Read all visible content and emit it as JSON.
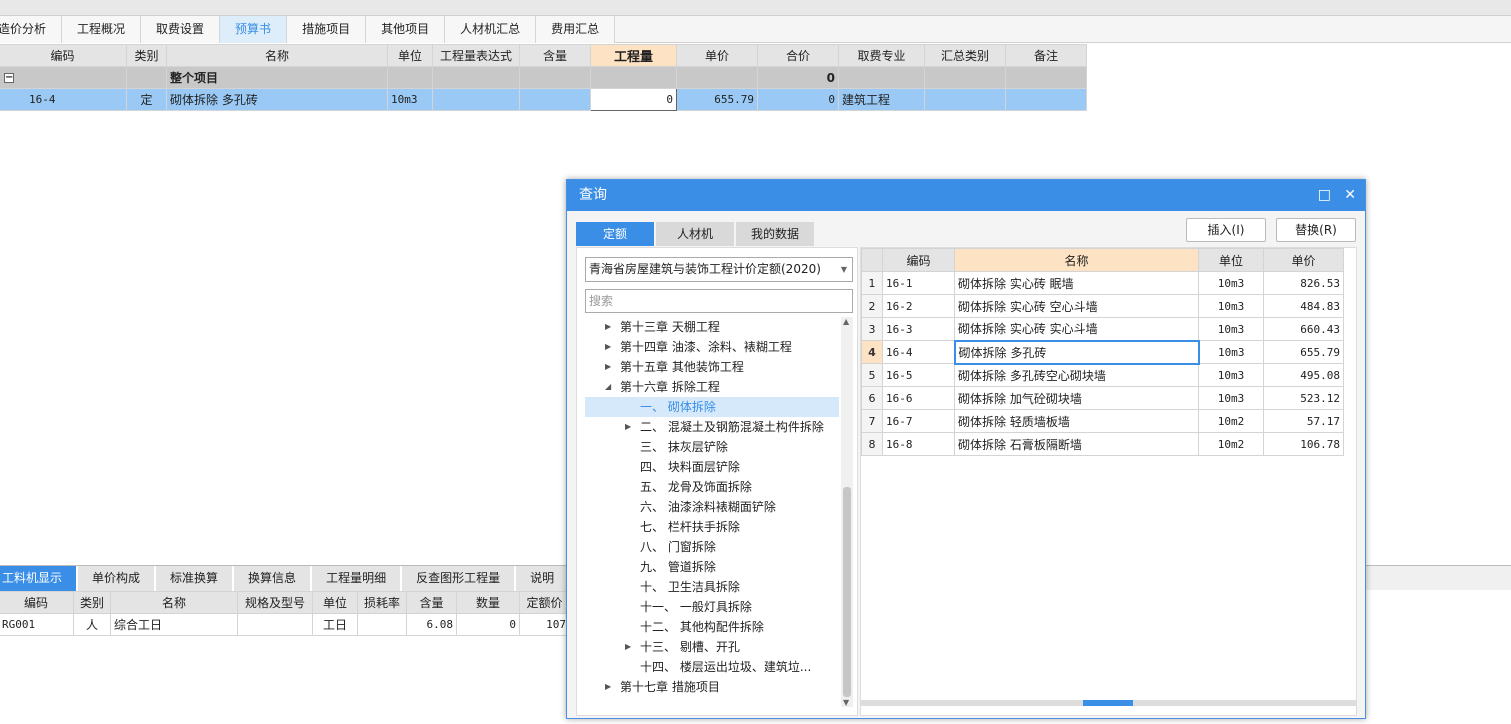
{
  "main_tabs": [
    "造价分析",
    "工程概况",
    "取费设置",
    "预算书",
    "措施项目",
    "其他项目",
    "人材机汇总",
    "费用汇总"
  ],
  "active_tab": 3,
  "main_grid": {
    "headers": [
      "编码",
      "类别",
      "名称",
      "单位",
      "工程量表达式",
      "含量",
      "工程量",
      "单价",
      "合价",
      "取费专业",
      "汇总类别",
      "备注"
    ],
    "group_row": {
      "name": "整个项目",
      "total": "0",
      "expander": "−"
    },
    "row": {
      "code": "16-4",
      "type": "定",
      "name": "砌体拆除 多孔砖",
      "unit": "10m3",
      "expr": "",
      "content": "",
      "qty": "0",
      "price": "655.79",
      "total": "0",
      "specialty": "建筑工程",
      "summary": "",
      "remark": ""
    }
  },
  "bottom_tabs": [
    "工料机显示",
    "单价构成",
    "标准换算",
    "换算信息",
    "工程量明细",
    "反查图形工程量",
    "说明"
  ],
  "bottom_active": 0,
  "bottom_grid": {
    "headers": [
      "编码",
      "类别",
      "名称",
      "规格及型号",
      "单位",
      "损耗率",
      "含量",
      "数量",
      "定额价"
    ],
    "row": {
      "code": "RG001",
      "type": "人",
      "name": "综合工日",
      "spec": "",
      "unit": "工日",
      "loss": "",
      "content": "6.08",
      "count": "0",
      "price": "107"
    }
  },
  "dialog": {
    "title": "查询",
    "restore_icon": "□",
    "close_icon": "✕",
    "tabs": [
      "定额",
      "人材机",
      "我的数据"
    ],
    "insert_label": "插入(I)",
    "replace_label": "替换(R)",
    "quota_select": "青海省房屋建筑与装饰工程计价定额(2020)",
    "search_placeholder": "搜索",
    "tree": [
      {
        "label": "第十三章 天棚工程",
        "level": 0,
        "arrow": "▶"
      },
      {
        "label": "第十四章 油漆、涂料、裱糊工程",
        "level": 0,
        "arrow": "▶"
      },
      {
        "label": "第十五章 其他装饰工程",
        "level": 0,
        "arrow": "▶"
      },
      {
        "label": "第十六章 拆除工程",
        "level": 0,
        "arrow": "◢"
      },
      {
        "label": "一、 砌体拆除",
        "level": 1,
        "arrow": "",
        "selected": true
      },
      {
        "label": "二、 混凝土及钢筋混凝土构件拆除",
        "level": 1,
        "arrow": "▶"
      },
      {
        "label": "三、 抹灰层铲除",
        "level": 1,
        "arrow": ""
      },
      {
        "label": "四、 块料面层铲除",
        "level": 1,
        "arrow": ""
      },
      {
        "label": "五、 龙骨及饰面拆除",
        "level": 1,
        "arrow": ""
      },
      {
        "label": "六、 油漆涂料裱糊面铲除",
        "level": 1,
        "arrow": ""
      },
      {
        "label": "七、 栏杆扶手拆除",
        "level": 1,
        "arrow": ""
      },
      {
        "label": "八、 门窗拆除",
        "level": 1,
        "arrow": ""
      },
      {
        "label": "九、 管道拆除",
        "level": 1,
        "arrow": ""
      },
      {
        "label": "十、 卫生洁具拆除",
        "level": 1,
        "arrow": ""
      },
      {
        "label": "十一、 一般灯具拆除",
        "level": 1,
        "arrow": ""
      },
      {
        "label": "十二、 其他构配件拆除",
        "level": 1,
        "arrow": ""
      },
      {
        "label": "十三、 剔槽、开孔",
        "level": 1,
        "arrow": "▶"
      },
      {
        "label": "十四、 楼层运出垃圾、建筑垃...",
        "level": 1,
        "arrow": ""
      },
      {
        "label": "第十七章 措施项目",
        "level": 0,
        "arrow": "▶"
      }
    ],
    "result_headers": [
      "编码",
      "名称",
      "单位",
      "单价"
    ],
    "results": [
      {
        "n": "1",
        "code": "16-1",
        "name": "砌体拆除 实心砖 眠墙",
        "unit": "10m3",
        "price": "826.53"
      },
      {
        "n": "2",
        "code": "16-2",
        "name": "砌体拆除 实心砖 空心斗墙",
        "unit": "10m3",
        "price": "484.83"
      },
      {
        "n": "3",
        "code": "16-3",
        "name": "砌体拆除 实心砖 实心斗墙",
        "unit": "10m3",
        "price": "660.43"
      },
      {
        "n": "4",
        "code": "16-4",
        "name": "砌体拆除 多孔砖",
        "unit": "10m3",
        "price": "655.79"
      },
      {
        "n": "5",
        "code": "16-5",
        "name": "砌体拆除 多孔砖空心砌块墙",
        "unit": "10m3",
        "price": "495.08"
      },
      {
        "n": "6",
        "code": "16-6",
        "name": "砌体拆除 加气砼砌块墙",
        "unit": "10m3",
        "price": "523.12"
      },
      {
        "n": "7",
        "code": "16-7",
        "name": "砌体拆除 轻质墙板墙",
        "unit": "10m2",
        "price": "57.17"
      },
      {
        "n": "8",
        "code": "16-8",
        "name": "砌体拆除 石膏板隔断墙",
        "unit": "10m2",
        "price": "106.78"
      }
    ],
    "current_result": 3
  }
}
